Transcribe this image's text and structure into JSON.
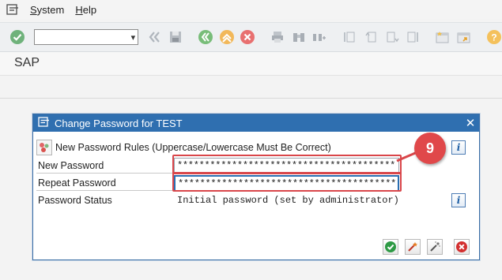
{
  "menubar": {
    "items": [
      {
        "label": "System",
        "underline": "S",
        "rest": "ystem"
      },
      {
        "label": "Help",
        "underline": "H",
        "rest": "elp"
      }
    ]
  },
  "toolbar": {
    "command_field_value": ""
  },
  "page": {
    "title": "SAP"
  },
  "dialog": {
    "title": "Change Password for TEST",
    "rules_label": "New Password Rules (Uppercase/Lowercase Must Be Correct)",
    "new_password_label": "New Password",
    "new_password_value": "****************************************",
    "repeat_password_label": "Repeat Password",
    "repeat_password_value": "****************************************",
    "status_label": "Password Status",
    "status_value": "Initial password (set by administrator)",
    "info_glyph": "i"
  },
  "annotation": {
    "step_number": "9",
    "color": "#e0484a"
  },
  "colors": {
    "dialog_header": "#2f6fb0",
    "accent_green": "#2e9a45",
    "accent_red": "#d32f2f",
    "accent_orange": "#f0a21b"
  }
}
